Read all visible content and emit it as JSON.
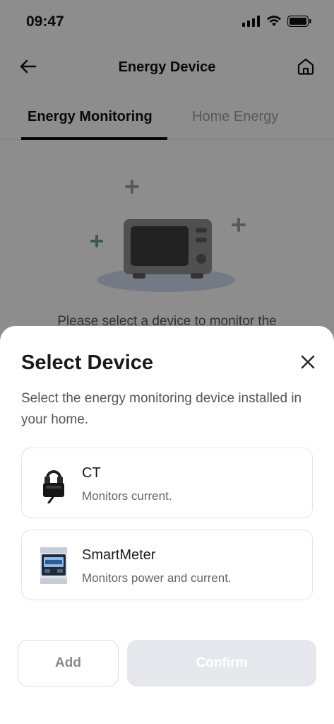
{
  "status_bar": {
    "time": "09:47"
  },
  "nav": {
    "title": "Energy Device"
  },
  "tabs": [
    {
      "label": "Energy Monitoring",
      "active": true
    },
    {
      "label": "Home Energy",
      "active": false
    }
  ],
  "empty_state": {
    "text": "Please select a device to monitor the"
  },
  "sheet": {
    "title": "Select Device",
    "description": "Select the energy monitoring device installed in your home.",
    "devices": [
      {
        "name": "CT",
        "description": "Monitors current.",
        "icon": "ct-clamp-icon"
      },
      {
        "name": "SmartMeter",
        "description": "Monitors power and current.",
        "icon": "smart-meter-icon"
      }
    ],
    "add_label": "Add",
    "confirm_label": "Confirm"
  },
  "colors": {
    "overlay": "#000000",
    "confirm_disabled_bg": "#e6e8ee",
    "sheet_bg": "#ffffff"
  }
}
